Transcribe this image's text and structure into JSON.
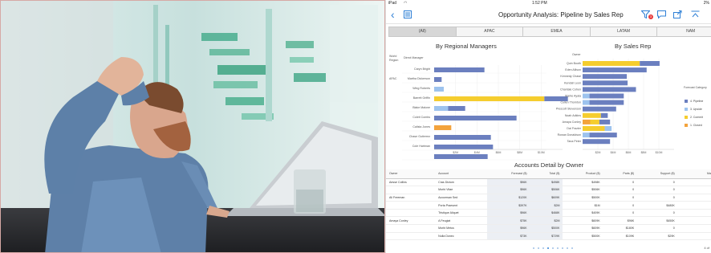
{
  "status_bar": {
    "device": "iPad",
    "time": "1:52 PM",
    "battery": "2%"
  },
  "nav": {
    "title": "Opportunity Analysis: Pipeline by Sales Rep",
    "filter_badge": "3"
  },
  "region_tabs": [
    "(All)",
    "APAC",
    "EMEA",
    "LATAM",
    "NAM"
  ],
  "region_selected": "(All)",
  "left_chart": {
    "title": "By Regional Managers",
    "col_region": "World Region",
    "col_manager": "Direct Manager",
    "region_label": "APAC",
    "managers": [
      "Caryn Bright",
      "Martha Dickerson",
      "Wing Roberts",
      "Barrett Griffin",
      "Blake Malone",
      "Coleti Combs",
      "Calista Jones",
      "Chase Gutierrez",
      "Cole Hartman",
      ""
    ],
    "ticks": [
      "$2M",
      "$4M",
      "$6M",
      "$8M",
      "$10M"
    ]
  },
  "right_chart": {
    "title": "By Sales Rep",
    "col_owner": "Owner",
    "owners": [
      "Quin Booth",
      "Eden Allison",
      "Kennedy Chase",
      "Kendall Leon",
      "Chantale Cohen",
      "Starke Ayala",
      "Cullen Thornton",
      "Prescott Stevenson",
      "Noah Adkins",
      "Amaya Conley",
      "Dai Frazier",
      "Rowan Donaldson",
      "Tana Peter"
    ],
    "ticks": [
      "$2M",
      "$4M",
      "$6M",
      "$8M",
      "$10M"
    ]
  },
  "legend": {
    "title": "Forecast Category",
    "items": [
      {
        "label": "4. Pipeline",
        "color": "#6b7fbf"
      },
      {
        "label": "3. Upside",
        "color": "#9dc3ee"
      },
      {
        "label": "2. Commit",
        "color": "#f5cd2e"
      },
      {
        "label": "1. Closed",
        "color": "#f3a33c"
      }
    ]
  },
  "chart_data": [
    {
      "type": "bar",
      "title": "By Regional Managers",
      "categories": [
        "Caryn Bright",
        "Martha Dickerson",
        "Wing Roberts",
        "Barrett Griffin",
        "Blake Malone",
        "Coleti Combs",
        "Calista Jones",
        "Chase Gutierrez",
        "Cole Hartman",
        ""
      ],
      "series": [
        {
          "name": "1. Closed",
          "values": [
            0,
            0,
            0,
            0,
            0,
            0,
            1.6,
            0,
            0,
            0
          ]
        },
        {
          "name": "2. Commit",
          "values": [
            0,
            0,
            0,
            10.3,
            0,
            0,
            0,
            0,
            0,
            0
          ]
        },
        {
          "name": "3. Upside",
          "values": [
            0,
            0,
            0.9,
            0,
            1.3,
            0,
            0,
            0,
            0,
            0
          ]
        },
        {
          "name": "4. Pipeline",
          "values": [
            4.7,
            0.7,
            0,
            2.2,
            1.6,
            7.7,
            0,
            5.3,
            5.5,
            5.0
          ]
        }
      ],
      "xlim": [
        0,
        12
      ]
    },
    {
      "type": "bar",
      "title": "By Sales Rep",
      "categories": [
        "Quin Booth",
        "Eden Allison",
        "Kennedy Chase",
        "Kendall Leon",
        "Chantale Cohen",
        "Starke Ayala",
        "Cullen Thornton",
        "Prescott Stevenson",
        "Noah Adkins",
        "Amaya Conley",
        "Dai Frazier",
        "Rowan Donaldson",
        "Tana Peter"
      ],
      "series": [
        {
          "name": "1. Closed",
          "values": [
            0,
            0,
            0,
            0,
            0,
            0,
            0,
            0,
            0,
            1.0,
            0,
            0,
            0
          ]
        },
        {
          "name": "2. Commit",
          "values": [
            7.5,
            0,
            0,
            0,
            0,
            0,
            0,
            0,
            2.4,
            1.2,
            2.9,
            0,
            0
          ]
        },
        {
          "name": "3. Upside",
          "values": [
            0,
            0,
            0,
            0,
            0,
            0.9,
            0.9,
            0,
            0,
            0,
            0.9,
            0.9,
            0
          ]
        },
        {
          "name": "4. Pipeline",
          "values": [
            2.6,
            8.4,
            5.8,
            5.9,
            7.0,
            4.5,
            4.5,
            4.4,
            0.9,
            1.4,
            0,
            3.6,
            3.6
          ]
        }
      ],
      "xlim": [
        0,
        12
      ]
    }
  ],
  "table": {
    "title": "Accounts Detail by Owner",
    "columns": [
      "Owner",
      "Account",
      "Forecast ($)",
      "Total ($)",
      "Product ($)",
      "Parts ($)",
      "Support ($)",
      "Maintenance ($)"
    ],
    "rows": [
      [
        "Aesse Collins",
        "Cras Dictum",
        "$96K",
        "$498K",
        "$498K",
        "0",
        "0",
        "0"
      ],
      [
        "",
        "Morbi Vitae",
        "$96K",
        "$506K",
        "$506K",
        "0",
        "0",
        "0"
      ],
      [
        "Ali Freeman",
        "Accumsan Sed",
        "$120K",
        "$609K",
        "$500K",
        "0",
        "0",
        "$109K"
      ],
      [
        "",
        "Porta Praesent",
        "$397K",
        "$2M",
        "$1M",
        "0",
        "$480K",
        "$279K"
      ],
      [
        "",
        "Tristique Aliquet",
        "$96K",
        "$468K",
        "$409K",
        "0",
        "0",
        "$59K"
      ],
      [
        "Amaya Conley",
        "A Feugiat",
        "$75K",
        "$2M",
        "$609K",
        "$96K",
        "$450K",
        "$269K"
      ],
      [
        "",
        "Morbi Metus",
        "$96K",
        "$500K",
        "$609K",
        "$180K",
        "0",
        "$109K"
      ],
      [
        "",
        "Nulla Donec",
        "$73K",
        "$729K",
        "$500K",
        "$109K",
        "$29K",
        "$109K"
      ]
    ]
  },
  "pager_text": "4 of"
}
